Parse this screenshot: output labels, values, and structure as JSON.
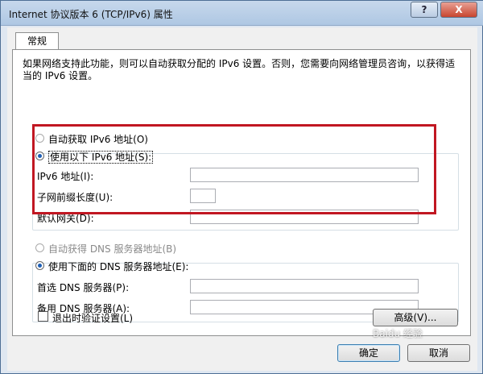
{
  "window": {
    "title": "Internet 协议版本 6 (TCP/IPv6) 属性",
    "help_label": "?",
    "close_label": "X"
  },
  "tabs": [
    {
      "label": "常规"
    }
  ],
  "description": "如果网络支持此功能，则可以自动获取分配的 IPv6 设置。否则，您需要向网络管理员咨询，以获得适当的 IPv6 设置。",
  "ip": {
    "auto_label": "自动获取 IPv6 地址(O)",
    "manual_label": "使用以下 IPv6 地址(S):",
    "selected": "manual",
    "fields": [
      {
        "label": "IPv6 地址(I):",
        "value": ""
      },
      {
        "label": "子网前缀长度(U):",
        "value": ""
      },
      {
        "label": "默认网关(D):",
        "value": ""
      }
    ]
  },
  "dns": {
    "auto_label": "自动获得 DNS 服务器地址(B)",
    "manual_label": "使用下面的 DNS 服务器地址(E):",
    "selected": "manual",
    "fields": [
      {
        "label": "首选 DNS 服务器(P):",
        "value": ""
      },
      {
        "label": "备用 DNS 服务器(A):",
        "value": ""
      }
    ]
  },
  "validate": {
    "label": "退出时验证设置(L)",
    "checked": false
  },
  "buttons": {
    "advanced": "高级(V)...",
    "ok": "确定",
    "cancel": "取消"
  },
  "watermark": "Baidu 经验"
}
